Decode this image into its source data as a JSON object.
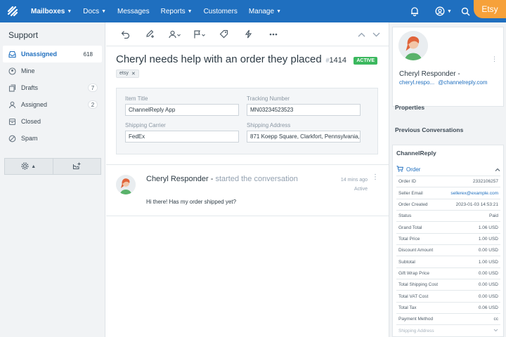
{
  "topnav": {
    "items": [
      {
        "label": "Mailboxes",
        "caret": true,
        "active": true
      },
      {
        "label": "Docs",
        "caret": true
      },
      {
        "label": "Messages",
        "caret": false
      },
      {
        "label": "Reports",
        "caret": true
      },
      {
        "label": "Customers",
        "caret": false
      },
      {
        "label": "Manage",
        "caret": true
      }
    ],
    "badge": "Etsy"
  },
  "sidebar": {
    "title": "Support",
    "folders": [
      {
        "label": "Unassigned",
        "count": "618",
        "icon": "inbox-icon"
      },
      {
        "label": "Mine",
        "count": "",
        "icon": "mine-icon"
      },
      {
        "label": "Drafts",
        "count": "7",
        "icon": "drafts-icon"
      },
      {
        "label": "Assigned",
        "count": "2",
        "icon": "user-icon"
      },
      {
        "label": "Closed",
        "count": "",
        "icon": "archive-icon"
      },
      {
        "label": "Spam",
        "count": "",
        "icon": "spam-icon"
      }
    ]
  },
  "conversation": {
    "subject": "Cheryl needs help with an order they placed",
    "number": "1414",
    "hash": "#",
    "status": "ACTIVE",
    "tag": "etsy",
    "fields": {
      "item_title_label": "Item Title",
      "item_title_value": "ChannelReply App",
      "tracking_label": "Tracking Number",
      "tracking_value": "MN03234523523",
      "carrier_label": "Shipping Carrier",
      "carrier_value": "FedEx",
      "address_label": "Shipping Address",
      "address_value": "871 Koepp Square, Clarkfort, Pennsylvania,"
    },
    "message": {
      "name": "Cheryl Responder -",
      "action": "started the conversation",
      "time": "14 mins ago",
      "status": "Active",
      "body": "Hi there! Has my order shipped yet?"
    }
  },
  "profile": {
    "name": "Cheryl Responder -",
    "email_part1": "cheryl.respo...",
    "email_part2": "@channelreply.com"
  },
  "right_sections": {
    "properties": "Properties",
    "previous": "Previous Conversations",
    "channelreply": "ChannelReply",
    "order_label": "Order"
  },
  "order_rows": [
    {
      "key": "Order ID",
      "value": "2332106257"
    },
    {
      "key": "Seller Email",
      "value": "sellerex@example.com",
      "link": true
    },
    {
      "key": "Order Created",
      "value": "2023-01-03 14:53:21"
    },
    {
      "key": "Status",
      "value": "Paid"
    },
    {
      "key": "Grand Total",
      "value": "1.06 USD"
    },
    {
      "key": "Total Price",
      "value": "1.00 USD"
    },
    {
      "key": "Discount Amount",
      "value": "0.00 USD"
    },
    {
      "key": "Subtotal",
      "value": "1.00 USD"
    },
    {
      "key": "Gift Wrap Price",
      "value": "0.00 USD"
    },
    {
      "key": "Total Shipping Cost",
      "value": "0.00 USD"
    },
    {
      "key": "Total VAT Cost",
      "value": "0.00 USD"
    },
    {
      "key": "Total Tax",
      "value": "0.06 USD"
    },
    {
      "key": "Payment Method",
      "value": "cc"
    },
    {
      "key": "Shipping Address",
      "value": "",
      "muted": true
    }
  ]
}
